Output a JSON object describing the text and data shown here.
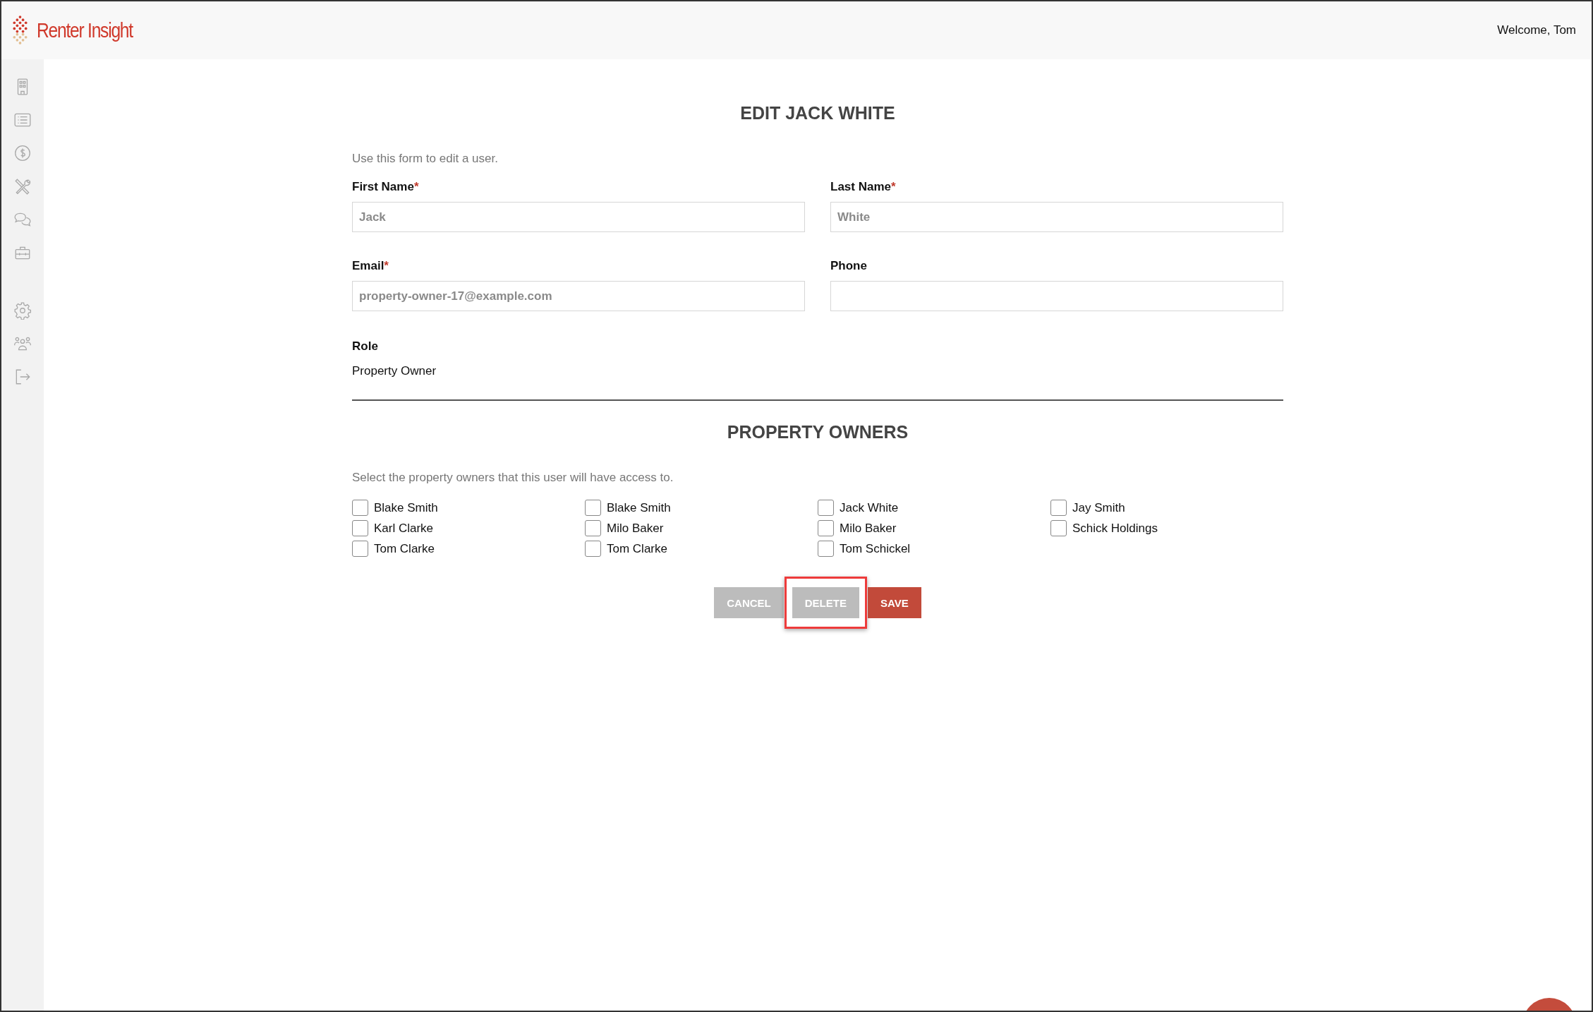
{
  "header": {
    "logo_text": "Renter Insight",
    "welcome": "Welcome, Tom"
  },
  "sidebar": {
    "items": [
      {
        "kind": "building"
      },
      {
        "kind": "list"
      },
      {
        "kind": "dollar"
      },
      {
        "kind": "tools"
      },
      {
        "kind": "chat"
      },
      {
        "kind": "briefcase"
      },
      {
        "kind": "settings"
      },
      {
        "kind": "users"
      },
      {
        "kind": "logout"
      }
    ]
  },
  "form": {
    "title": "EDIT JACK WHITE",
    "description": "Use this form to edit a user.",
    "fields": [
      {
        "label": "First Name",
        "required_mark": "*",
        "value": "Jack"
      },
      {
        "label": "Last Name",
        "required_mark": "*",
        "value": "White"
      },
      {
        "label": "Email",
        "required_mark": "*",
        "value": "property-owner-17@example.com"
      },
      {
        "label": "Phone"
      }
    ],
    "role_label": "Role",
    "role_value": "Property Owner"
  },
  "owners": {
    "title": "PROPERTY OWNERS",
    "description": "Select the property owners that this user will have access to.",
    "items": [
      {
        "label": "Blake Smith",
        "checked": false
      },
      {
        "label": "Karl Clarke",
        "checked": false
      },
      {
        "label": "Tom Clarke",
        "checked": false
      },
      {
        "label": "Blake Smith",
        "checked": false
      },
      {
        "label": "Milo Baker",
        "checked": false
      },
      {
        "label": "Tom Clarke",
        "checked": false
      },
      {
        "label": "Jack White",
        "checked": false
      },
      {
        "label": "Milo Baker",
        "checked": false
      },
      {
        "label": "Tom Schickel",
        "checked": false
      },
      {
        "label": "Jay Smith",
        "checked": false
      },
      {
        "label": "Schick Holdings",
        "checked": false
      }
    ]
  },
  "buttons": [
    {
      "label": "CANCEL",
      "kind": "secondary",
      "highlighted": false
    },
    {
      "label": "DELETE",
      "kind": "secondary",
      "highlighted": true
    },
    {
      "label": "SAVE",
      "kind": "primary",
      "highlighted": false
    }
  ]
}
